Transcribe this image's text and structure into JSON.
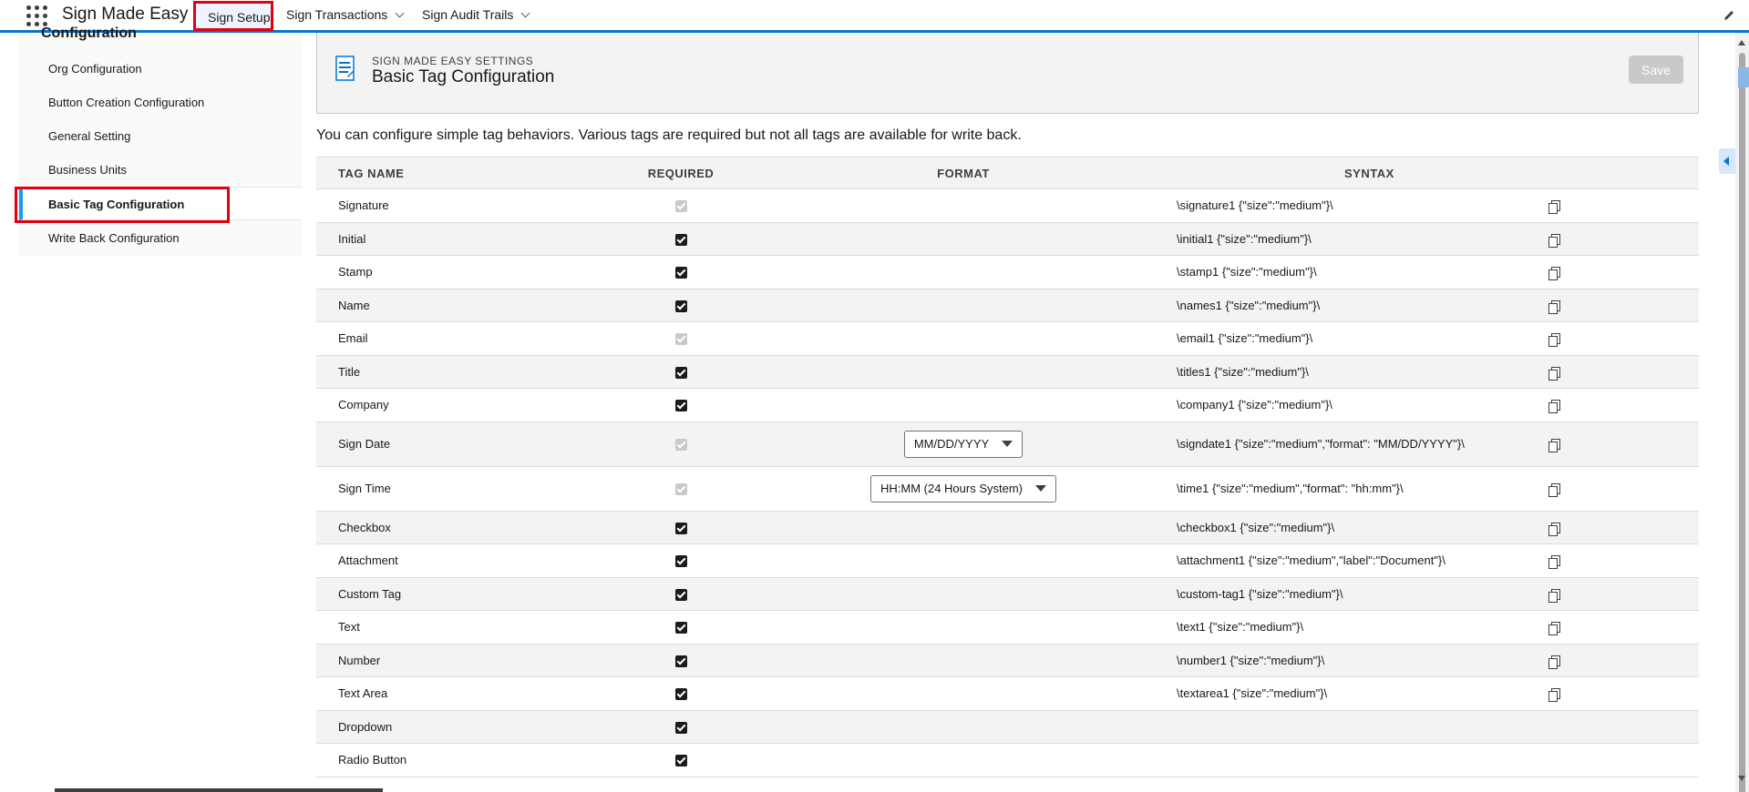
{
  "topnav": {
    "app_name": "Sign Made Easy",
    "items": [
      {
        "label": "Sign Setup",
        "active": true
      },
      {
        "label": "Sign Transactions",
        "has_dropdown": true
      },
      {
        "label": "Sign Audit Trails",
        "has_dropdown": true
      }
    ]
  },
  "sidebar": {
    "heading": "Configuration",
    "items": [
      {
        "label": "Org Configuration"
      },
      {
        "label": "Button Creation Configuration"
      },
      {
        "label": "General Setting"
      },
      {
        "label": "Business Units"
      },
      {
        "label": "Basic Tag Configuration",
        "active": true
      },
      {
        "label": "Write Back Configuration"
      }
    ]
  },
  "header": {
    "eyebrow": "SIGN MADE EASY SETTINGS",
    "title": "Basic Tag Configuration",
    "save_label": "Save"
  },
  "intro": "You can configure simple tag behaviors. Various tags are required but not all tags are available for write back.",
  "table": {
    "columns": [
      "TAG NAME",
      "REQUIRED",
      "FORMAT",
      "SYNTAX"
    ],
    "rows": [
      {
        "name": "Signature",
        "required": true,
        "disabled": true,
        "format": "",
        "syntax": "\\signature1 {\"size\":\"medium\"}\\"
      },
      {
        "name": "Initial",
        "required": true,
        "disabled": false,
        "format": "",
        "syntax": "\\initial1 {\"size\":\"medium\"}\\"
      },
      {
        "name": "Stamp",
        "required": true,
        "disabled": false,
        "format": "",
        "syntax": "\\stamp1 {\"size\":\"medium\"}\\"
      },
      {
        "name": "Name",
        "required": true,
        "disabled": false,
        "format": "",
        "syntax": "\\names1 {\"size\":\"medium\"}\\"
      },
      {
        "name": "Email",
        "required": true,
        "disabled": true,
        "format": "",
        "syntax": "\\email1 {\"size\":\"medium\"}\\"
      },
      {
        "name": "Title",
        "required": true,
        "disabled": false,
        "format": "",
        "syntax": "\\titles1 {\"size\":\"medium\"}\\"
      },
      {
        "name": "Company",
        "required": true,
        "disabled": false,
        "format": "",
        "syntax": "\\company1 {\"size\":\"medium\"}\\"
      },
      {
        "name": "Sign Date",
        "required": true,
        "disabled": true,
        "format": "MM/DD/YYYY",
        "syntax": "\\signdate1 {\"size\":\"medium\",\"format\": \"MM/DD/YYYY\"}\\"
      },
      {
        "name": "Sign Time",
        "required": true,
        "disabled": true,
        "format": "HH:MM (24 Hours System)",
        "syntax": "\\time1 {\"size\":\"medium\",\"format\": \"hh:mm\"}\\"
      },
      {
        "name": "Checkbox",
        "required": true,
        "disabled": false,
        "format": "",
        "syntax": "\\checkbox1 {\"size\":\"medium\"}\\"
      },
      {
        "name": "Attachment",
        "required": true,
        "disabled": false,
        "format": "",
        "syntax": "\\attachment1 {\"size\":\"medium\",\"label\":\"Document\"}\\"
      },
      {
        "name": "Custom Tag",
        "required": true,
        "disabled": false,
        "format": "",
        "syntax": "\\custom-tag1 {\"size\":\"medium\"}\\"
      },
      {
        "name": "Text",
        "required": true,
        "disabled": false,
        "format": "",
        "syntax": "\\text1 {\"size\":\"medium\"}\\"
      },
      {
        "name": "Number",
        "required": true,
        "disabled": false,
        "format": "",
        "syntax": "\\number1 {\"size\":\"medium\"}\\"
      },
      {
        "name": "Text Area",
        "required": true,
        "disabled": false,
        "format": "",
        "syntax": "\\textarea1 {\"size\":\"medium\"}\\"
      },
      {
        "name": "Dropdown",
        "required": true,
        "disabled": false,
        "format": "",
        "syntax": ""
      },
      {
        "name": "Radio Button",
        "required": true,
        "disabled": false,
        "format": "",
        "syntax": ""
      }
    ]
  },
  "colors": {
    "brand_blue": "#0176d3",
    "highlight_red": "#e3000f",
    "active_indicator": "#1b96ff"
  }
}
